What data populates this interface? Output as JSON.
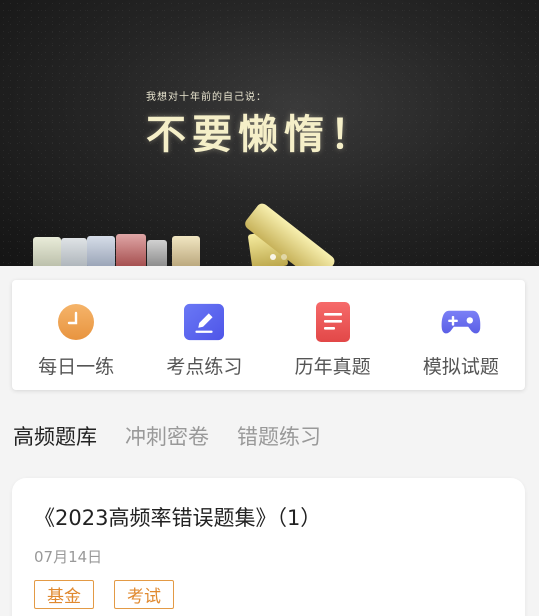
{
  "banner": {
    "small_text": "我想对十年前的自己说：",
    "big_text": "不要懒惰！",
    "slide_count": 2,
    "active_slide": 1
  },
  "menu": {
    "items": [
      {
        "label": "每日一练",
        "icon": "clock-icon",
        "color": "#f0a95a"
      },
      {
        "label": "考点练习",
        "icon": "pencil-edit-icon",
        "color": "#5b63f0"
      },
      {
        "label": "历年真题",
        "icon": "document-icon",
        "color": "#ef5b5b"
      },
      {
        "label": "模拟试题",
        "icon": "gamepad-icon",
        "color": "#6b6ff2"
      }
    ]
  },
  "tabs": {
    "items": [
      "高频题库",
      "冲刺密卷",
      "错题练习"
    ],
    "active_index": 0
  },
  "questions": [
    {
      "title": "《2023高频率错误题集》（1）",
      "date": "07月14日",
      "tags": [
        "基金",
        "考试"
      ]
    }
  ],
  "colors": {
    "tag_accent": "#e0892f",
    "background": "#f4f4f4"
  }
}
